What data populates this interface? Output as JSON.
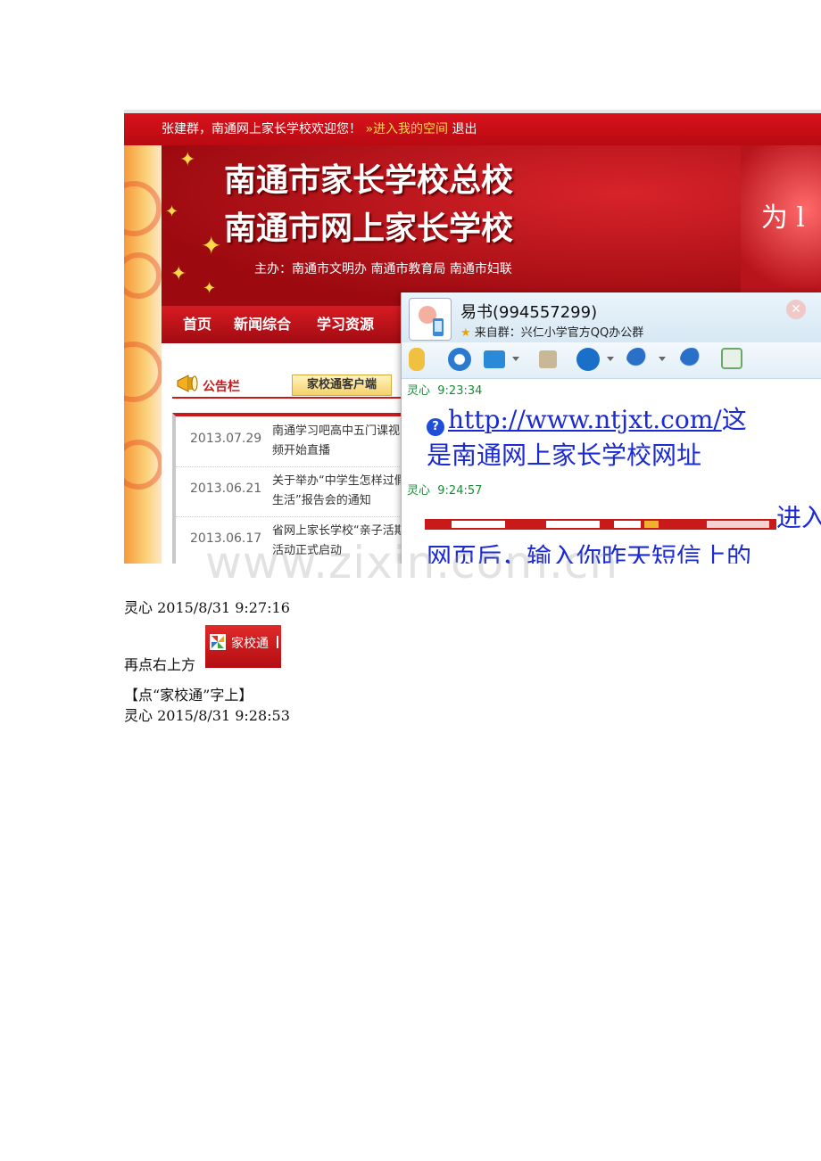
{
  "screenshot": {
    "topbar": {
      "greeting": "张建群，南通网上家长学校欢迎您！",
      "space_link": "»进入我的空间",
      "logout": "退出"
    },
    "banner": {
      "title_line1": "南通市家长学校总校",
      "title_line2": "南通市网上家长学校",
      "sponsor": "主办：南通市文明办  南通市教育局  南通市妇联",
      "calligraphy": "为 l"
    },
    "nav": {
      "items": [
        "首页",
        "新闻综合",
        "学习资源"
      ]
    },
    "notice": {
      "title": "公告栏",
      "client_button": "家校通客户端",
      "news": [
        {
          "date": "2013.07.29",
          "text": "南通学习吧高中五门课视频开始直播"
        },
        {
          "date": "2013.06.21",
          "text": "关于举办“中学生怎样过假生活”报告会的通知"
        },
        {
          "date": "2013.06.17",
          "text": "省网上家长学校“亲子活期活动正式启动"
        }
      ]
    },
    "qq": {
      "name": "易书(994557299)",
      "source": "来自群：兴仁小学官方QQ办公群",
      "messages": [
        {
          "sender": "灵心",
          "time": "9:23:34",
          "link": "http://www.ntjxt.com/",
          "after_link": "这",
          "line2": "是南通网上家长学校网址"
        },
        {
          "sender": "灵心",
          "time": "9:24:57",
          "right_text": "进入",
          "line2": "网页后，输入你昨天短信上的"
        }
      ]
    }
  },
  "watermark": "www.zixin.com.cn",
  "doc": {
    "line1": "灵心   2015/8/31   9:27:16",
    "line2_text": "再点右上方",
    "jxt_label": "家校通",
    "line3": "【点“家校通”字上】",
    "line4": "灵心   2015/8/31   9:28:53"
  }
}
